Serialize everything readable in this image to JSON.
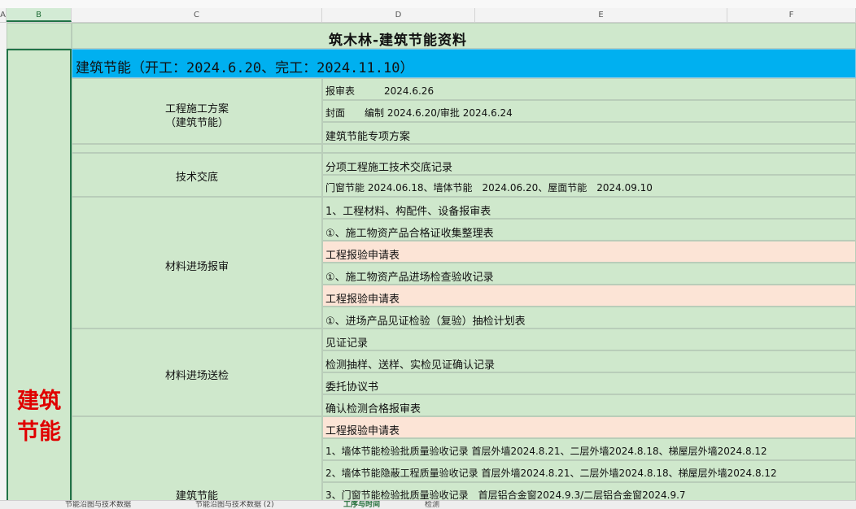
{
  "columns": [
    "A",
    "B",
    "C",
    "D",
    "E",
    "F"
  ],
  "title": "筑木林-建筑节能资料",
  "side_label_line1": "建筑",
  "side_label_line2": "节能",
  "header_row": "建筑节能（开工：2024.6.20、完工：2024.11.10）",
  "groups": {
    "g1": "工程施工方案",
    "g1b": "（建筑节能）",
    "g2": "技术交底",
    "g3": "材料进场报审",
    "g4": "材料进场送检",
    "g5": "建筑节能"
  },
  "rows": [
    "报审表　　　2024.6.26",
    "封面　　编制 2024.6.20/审批 2024.6.24",
    "建筑节能专项方案",
    "",
    "分项工程施工技术交底记录",
    "门窗节能 2024.06.18、墙体节能　2024.06.20、屋面节能　2024.09.10",
    "1、工程材料、构配件、设备报审表",
    "①、施工物资产品合格证收集整理表",
    "工程报验申请表",
    "①、施工物资产品进场检查验收记录",
    "工程报验申请表",
    "①、进场产品见证检验（复验）抽检计划表",
    "见证记录",
    "检测抽样、送样、实检见证确认记录",
    "委托协议书",
    "确认检测合格报审表",
    "工程报验申请表",
    "1、墙体节能检验批质量验收记录 首层外墙2024.8.21、二层外墙2024.8.18、梯屋层外墙2024.8.12",
    "2、墙体节能隐蔽工程质量验收记录 首层外墙2024.8.21、二层外墙2024.8.18、梯屋层外墙2024.8.12",
    "3、门窗节能检验批质量验收记录　首层铝合金窗2024.9.3/二层铝合金窗2024.9.7"
  ],
  "sheet_tabs": [
    "节能沿图与技术数据",
    "节能沿图与技术数据 (2)",
    "工序与时间",
    "检测"
  ],
  "colors": {
    "green": "#cfe8cc",
    "blue": "#00b0f0",
    "peach": "#fce4d6",
    "red": "#e00000"
  }
}
